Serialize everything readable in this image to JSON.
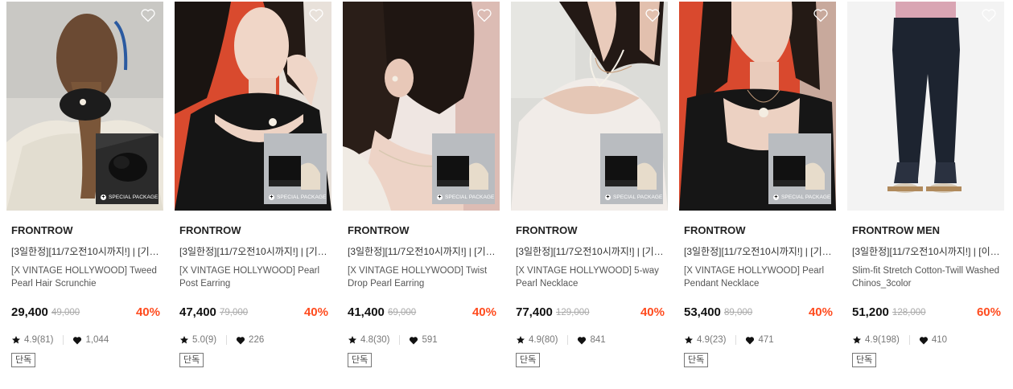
{
  "package_label": "SPECIAL PACKAGE",
  "colors": {
    "discount": "#ff4b1e",
    "text": "#222222",
    "muted": "#aaaaaa"
  },
  "icons": {
    "wishlist": "heart-outline-icon",
    "rating": "star-icon",
    "likes": "heart-icon"
  },
  "products": [
    {
      "brand": "FRONTROW",
      "title_line1": "[3일한정][11/7오전10시까지!] | [기프…",
      "title_line2": "[X VINTAGE HOLLYWOOD] Tweed Pearl Hair Scrunchie",
      "price": "29,400",
      "original_price": "49,000",
      "discount": "40%",
      "rating": "4.9(81)",
      "likes": "1,044",
      "badge": "단독",
      "special_package": true
    },
    {
      "brand": "FRONTROW",
      "title_line1": "[3일한정][11/7오전10시까지!] | [기프…",
      "title_line2": "[X VINTAGE HOLLYWOOD] Pearl Post Earring",
      "price": "47,400",
      "original_price": "79,000",
      "discount": "40%",
      "rating": "5.0(9)",
      "likes": "226",
      "badge": "단독",
      "special_package": true
    },
    {
      "brand": "FRONTROW",
      "title_line1": "[3일한정][11/7오전10시까지!] | [기프…",
      "title_line2": "[X VINTAGE HOLLYWOOD] Twist Drop Pearl Earring",
      "price": "41,400",
      "original_price": "69,000",
      "discount": "40%",
      "rating": "4.8(30)",
      "likes": "591",
      "badge": "단독",
      "special_package": true
    },
    {
      "brand": "FRONTROW",
      "title_line1": "[3일한정][11/7오전10시까지!] | [기프…",
      "title_line2": "[X VINTAGE HOLLYWOOD] 5-way Pearl Necklace",
      "price": "77,400",
      "original_price": "129,000",
      "discount": "40%",
      "rating": "4.9(80)",
      "likes": "841",
      "badge": "단독",
      "special_package": true
    },
    {
      "brand": "FRONTROW",
      "title_line1": "[3일한정][11/7오전10시까지!] | [기프…",
      "title_line2": "[X VINTAGE HOLLYWOOD] Pearl Pendant Necklace",
      "price": "53,400",
      "original_price": "89,000",
      "discount": "40%",
      "rating": "4.9(23)",
      "likes": "471",
      "badge": "단독",
      "special_package": true
    },
    {
      "brand": "FRONTROW MEN",
      "title_line1": "[3일한정][11/7오전10시까지!] | [이선…",
      "title_line2": "Slim-fit Stretch Cotton-Twill Washed Chinos_3color",
      "price": "51,200",
      "original_price": "128,000",
      "discount": "60%",
      "rating": "4.9(198)",
      "likes": "410",
      "badge": "단독",
      "special_package": false
    }
  ]
}
